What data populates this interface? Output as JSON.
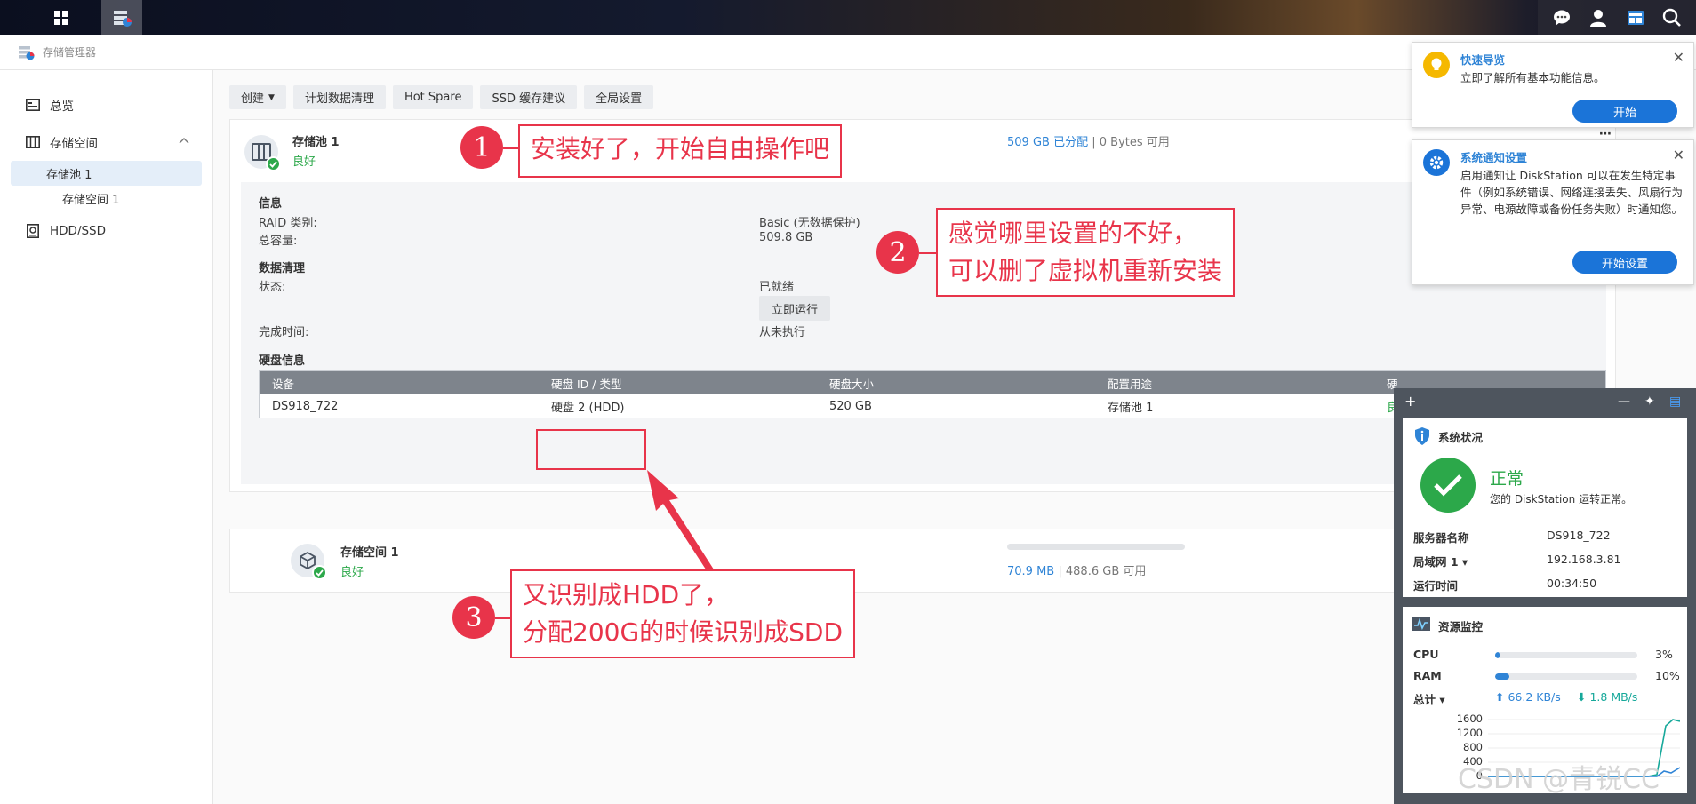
{
  "window": {
    "title": "存储管理器"
  },
  "sidebar": {
    "overview": "总览",
    "storage": "存储空间",
    "pool": "存储池 1",
    "volume": "存储空间 1",
    "hdd": "HDD/SSD"
  },
  "toolbar": {
    "create": "创建",
    "scrub": "计划数据清理",
    "hotspare": "Hot Spare",
    "ssd": "SSD 缓存建议",
    "global": "全局设置"
  },
  "pool": {
    "name": "存储池 1",
    "status": "良好",
    "allocated": "509 GB 已分配",
    "sep": "|",
    "available": "0 Bytes 可用",
    "info_title": "信息",
    "raid_label": "RAID 类别:",
    "raid_value": "Basic (无数据保护)",
    "capacity_label": "总容量:",
    "capacity_value": "509.8 GB",
    "scrub_title": "数据清理",
    "state_label": "状态:",
    "state_value": "已就绪",
    "run_now": "立即运行",
    "done_label": "完成时间:",
    "done_value": "从未执行",
    "disk_title": "硬盘信息",
    "disk_headers": [
      "设备",
      "硬盘 ID / 类型",
      "硬盘大小",
      "配置用途",
      "硬"
    ],
    "disk_row": [
      "DS918_722",
      "硬盘 2 (HDD)",
      "520 GB",
      "存储池 1",
      "良"
    ]
  },
  "volume": {
    "name": "存储空间 1",
    "status": "良好",
    "used": "70.9 MB",
    "sep": "|",
    "available": "488.6 GB 可用",
    "used_fraction": 0.0001
  },
  "notifications": [
    {
      "title": "快速导览",
      "body": "立即了解所有基本功能信息。",
      "button": "开始"
    },
    {
      "title": "系统通知设置",
      "body": "启用通知让 DiskStation 可以在发生特定事件（例如系统错误、网络连接丢失、风扇行为异常、电源故障或备份任务失败）时通知您。",
      "button": "开始设置"
    }
  ],
  "widgets": {
    "status": {
      "title": "系统状况",
      "state": "正常",
      "message": "您的 DiskStation 运转正常。",
      "rows": [
        {
          "k": "服务器名称",
          "v": "DS918_722"
        },
        {
          "k": "局域网 1 ▾",
          "v": "192.168.3.81"
        },
        {
          "k": "运行时间",
          "v": "00:34:50"
        }
      ]
    },
    "monitor": {
      "title": "资源监控",
      "cpu_label": "CPU",
      "cpu_pct": "3%",
      "cpu_value": 3,
      "ram_label": "RAM",
      "ram_pct": "10%",
      "ram_value": 10,
      "total_label": "总计 ▾",
      "upload": "66.2 KB/s",
      "download": "1.8 MB/s",
      "y_ticks": [
        "1600",
        "1200",
        "800",
        "400",
        "0"
      ]
    }
  },
  "annotations": {
    "n1": "1",
    "t1": "安装好了，开始自由操作吧",
    "n2": "2",
    "t2a": "感觉哪里设置的不好，",
    "t2b": "可以删了虚拟机重新安装",
    "n3": "3",
    "t3a": "又识别成HDD了，",
    "t3b": "分配200G的时候识别成SDD"
  },
  "watermark": "CSDN @青锐CC",
  "colors": {
    "accent": "#2f84d6",
    "ok": "#2ca84a",
    "annotation": "#e8344a",
    "button": "#1b74d8"
  }
}
